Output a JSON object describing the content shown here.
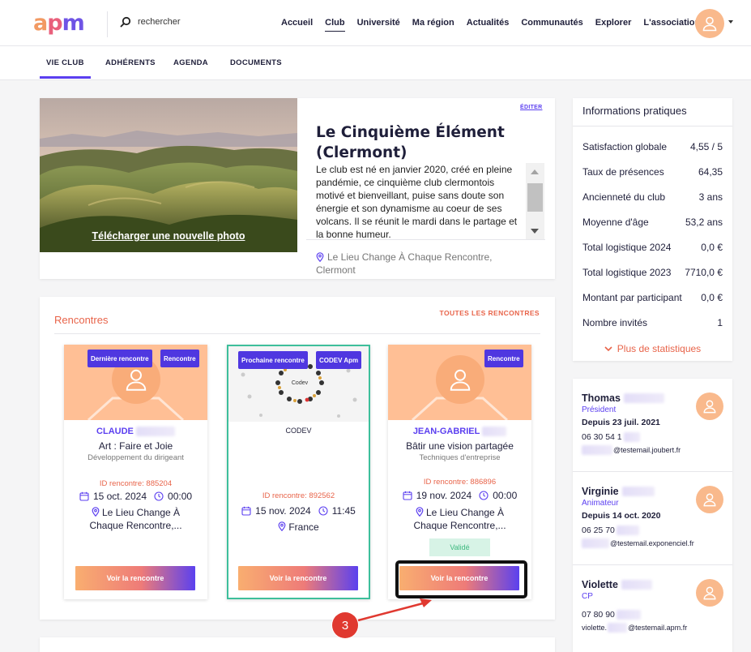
{
  "header": {
    "logo": {
      "a": "a",
      "p": "p",
      "m": "m",
      "colors": [
        "#f29a63",
        "#e9607c",
        "#6f54e5"
      ]
    },
    "search_placeholder": "rechercher",
    "nav": [
      {
        "label": "Accueil",
        "active": false
      },
      {
        "label": "Club",
        "active": true
      },
      {
        "label": "Université",
        "active": false
      },
      {
        "label": "Ma région",
        "active": false
      },
      {
        "label": "Actualités",
        "active": false
      },
      {
        "label": "Communautés",
        "active": false
      },
      {
        "label": "Explorer",
        "active": false
      },
      {
        "label": "L'association",
        "active": false
      }
    ]
  },
  "subnav": {
    "tabs": [
      {
        "label": "VIE CLUB",
        "active": true
      },
      {
        "label": "ADHÉRENTS",
        "active": false
      },
      {
        "label": "AGENDA",
        "active": false
      },
      {
        "label": "DOCUMENTS",
        "active": false
      }
    ]
  },
  "club": {
    "upload_label": "Télécharger une nouvelle photo",
    "edit_label": "ÉDITER",
    "title": "Le Cinquième Élément (Clermont)",
    "description": "Le club est né en janvier 2020, créé en pleine pandémie, ce cinquième club clermontois motivé et bienveillant,  puise sans doute son énergie et son dynamisme au coeur de ses volcans. Il se réunit le mardi dans le partage et la bonne humeur.",
    "location": "Le Lieu Change À Chaque Rencontre, Clermont"
  },
  "meetings": {
    "title": "Rencontres",
    "all_label": "TOUTES LES RENCONTRES",
    "cards": [
      {
        "badges": [
          "Dernière rencontre",
          "Rencontre"
        ],
        "name": "CLAUDE",
        "title": "Art : Faire et Joie",
        "subtitle": "Développement du dirigeant",
        "id_label": "ID rencontre: 885204",
        "date": "15 oct. 2024",
        "time": "00:00",
        "location": "Le Lieu Change À Chaque Rencontre,...",
        "status": "",
        "button": "Voir la rencontre"
      },
      {
        "badges": [
          "Prochaine rencontre",
          "CODEV Apm"
        ],
        "name": "CODEV",
        "title": "",
        "subtitle": "",
        "id_label": "ID rencontre: 892562",
        "date": "15 nov. 2024",
        "time": "11:45",
        "location": "France",
        "status": "",
        "button": "Voir la rencontre",
        "image_caption": "Codev"
      },
      {
        "badges": [
          "Rencontre"
        ],
        "name": "JEAN-GABRIEL",
        "title": "Bâtir une vision partagée",
        "subtitle": "Techniques d'entreprise",
        "id_label": "ID rencontre: 886896",
        "date": "19 nov. 2024",
        "time": "00:00",
        "location": "Le Lieu Change À Chaque Rencontre,...",
        "status": "Validé",
        "button": "Voir la rencontre"
      }
    ]
  },
  "annotation": {
    "step": "3"
  },
  "info": {
    "title": "Informations pratiques",
    "rows": [
      {
        "label": "Satisfaction globale",
        "value": "4,55 / 5"
      },
      {
        "label": "Taux de présences",
        "value": "64,35"
      },
      {
        "label": "Ancienneté du club",
        "value": "3 ans"
      },
      {
        "label": "Moyenne d'âge",
        "value": "53,2 ans"
      },
      {
        "label": "Total logistique 2024",
        "value": "0,0 €"
      },
      {
        "label": "Total logistique 2023",
        "value": "7710,0 €"
      },
      {
        "label": "Montant par participant",
        "value": "0,0 €"
      },
      {
        "label": "Nombre invités",
        "value": "1"
      }
    ],
    "more": "Plus de statistiques"
  },
  "contacts": [
    {
      "name": "Thomas",
      "role": "Président",
      "since": "Depuis 23 juil. 2021",
      "phone": "06 30 54 1",
      "email_prefix": "",
      "email_domain": "@testemail.joubert.fr"
    },
    {
      "name": "Virginie",
      "role": "Animateur",
      "since": "Depuis 14 oct. 2020",
      "phone": "06 25 70",
      "email_prefix": "",
      "email_domain": "@testemail.exponenciel.fr"
    },
    {
      "name": "Violette",
      "role": "CP",
      "since": "",
      "phone": "07 80 90",
      "email_prefix": "violette.",
      "email_domain": "@testemail.apm.fr"
    }
  ],
  "colors": {
    "accent": "#5b3ff0",
    "coral": "#e8644a",
    "badge": "#4f37e0",
    "next_border": "#3dbf9b",
    "annotation": "#e03930"
  }
}
